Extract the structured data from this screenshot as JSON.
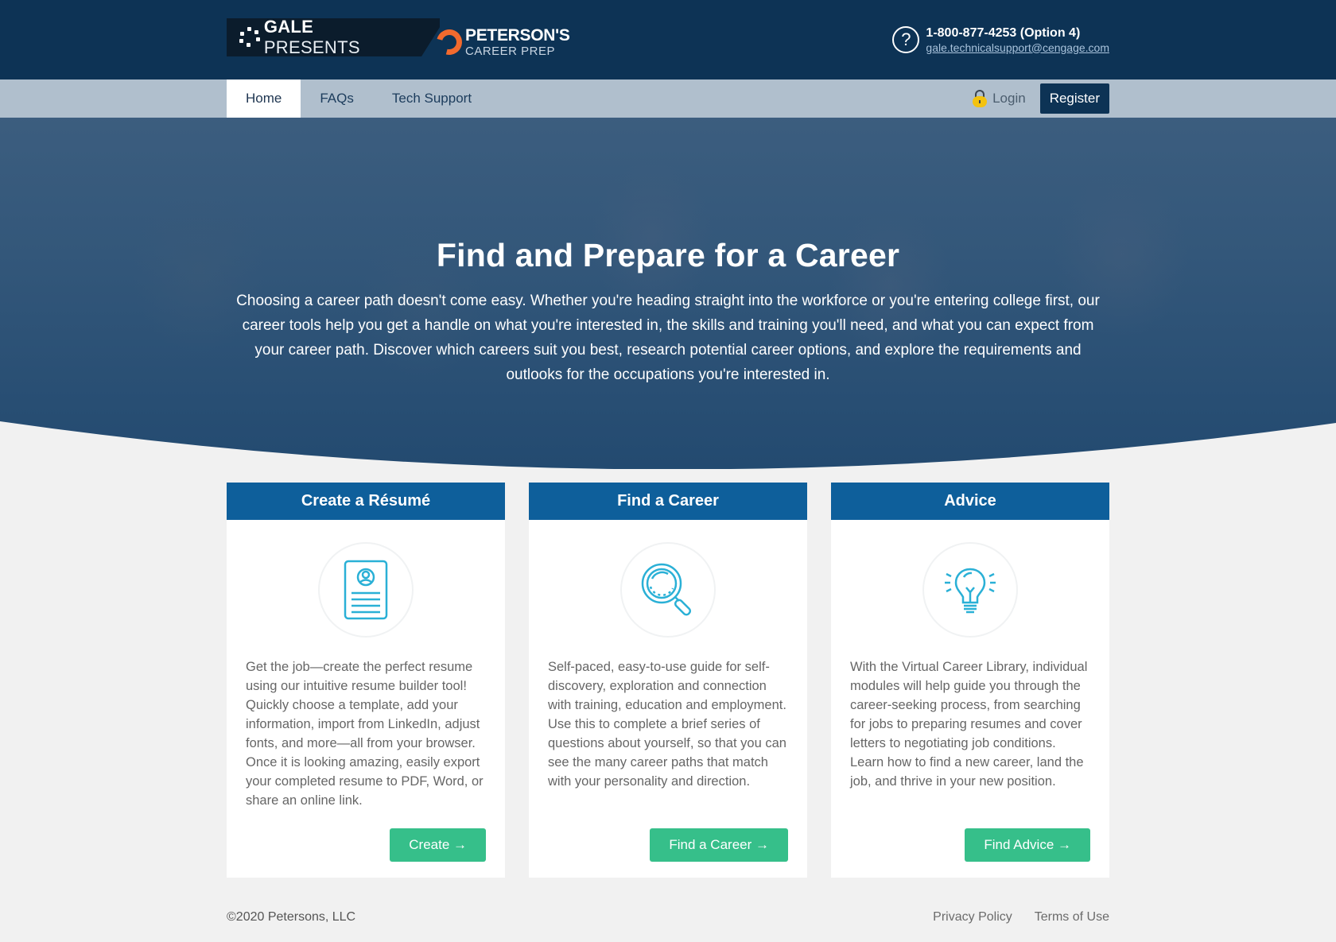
{
  "header": {
    "gale_bold": "GALE",
    "gale_light": "PRESENTS",
    "petersons_name": "PETERSON'S",
    "petersons_sub": "CAREER PREP",
    "phone": "1-800-877-4253 (Option 4)",
    "email": "gale.technicalsupport@cengage.com"
  },
  "nav": {
    "tabs": [
      {
        "label": "Home",
        "active": true
      },
      {
        "label": "FAQs"
      },
      {
        "label": "Tech Support"
      }
    ],
    "login": "Login",
    "register": "Register"
  },
  "hero": {
    "title": "Find and Prepare for a Career",
    "text": "Choosing a career path doesn't come easy. Whether you're heading straight into the workforce or you're entering college first, our career tools help you get a handle on what you're interested in, the skills and training you'll need, and what you can expect from your career path. Discover which careers suit you best, research potential career options, and explore the requirements and outlooks for the occupations you're interested in."
  },
  "cards": [
    {
      "title": "Create a Résumé",
      "icon": "resume-icon",
      "text": "Get the job—create the perfect resume using our intuitive resume builder tool! Quickly choose a template, add your information, import from LinkedIn, adjust fonts, and more—all from your browser. Once it is looking amazing, easily export your completed resume to PDF, Word, or share an online link.",
      "button": "Create →"
    },
    {
      "title": "Find a Career",
      "icon": "magnifier-icon",
      "text": "Self-paced, easy-to-use guide for self-discovery, exploration and connection with training, education and employment. Use this to complete a brief series of questions about yourself, so that you can see the many career paths that match with your personality and direction.",
      "button": "Find a Career →"
    },
    {
      "title": "Advice",
      "icon": "lightbulb-icon",
      "text": "With the Virtual Career Library, individual modules will help guide you through the career-seeking process, from searching for jobs to preparing resumes and cover letters to negotiating job conditions. Learn how to find a new career, land the job, and thrive in your new position.",
      "button": "Find Advice →"
    }
  ],
  "footer": {
    "copyright": "©2020 Petersons, LLC",
    "links": [
      "Privacy Policy",
      "Terms of Use"
    ]
  },
  "colors": {
    "header_bg": "#0d3355",
    "card_header": "#0e5f9b",
    "button_green": "#36bf8a",
    "icon_blue": "#2ab0d6",
    "accent_orange": "#f26a2e"
  }
}
